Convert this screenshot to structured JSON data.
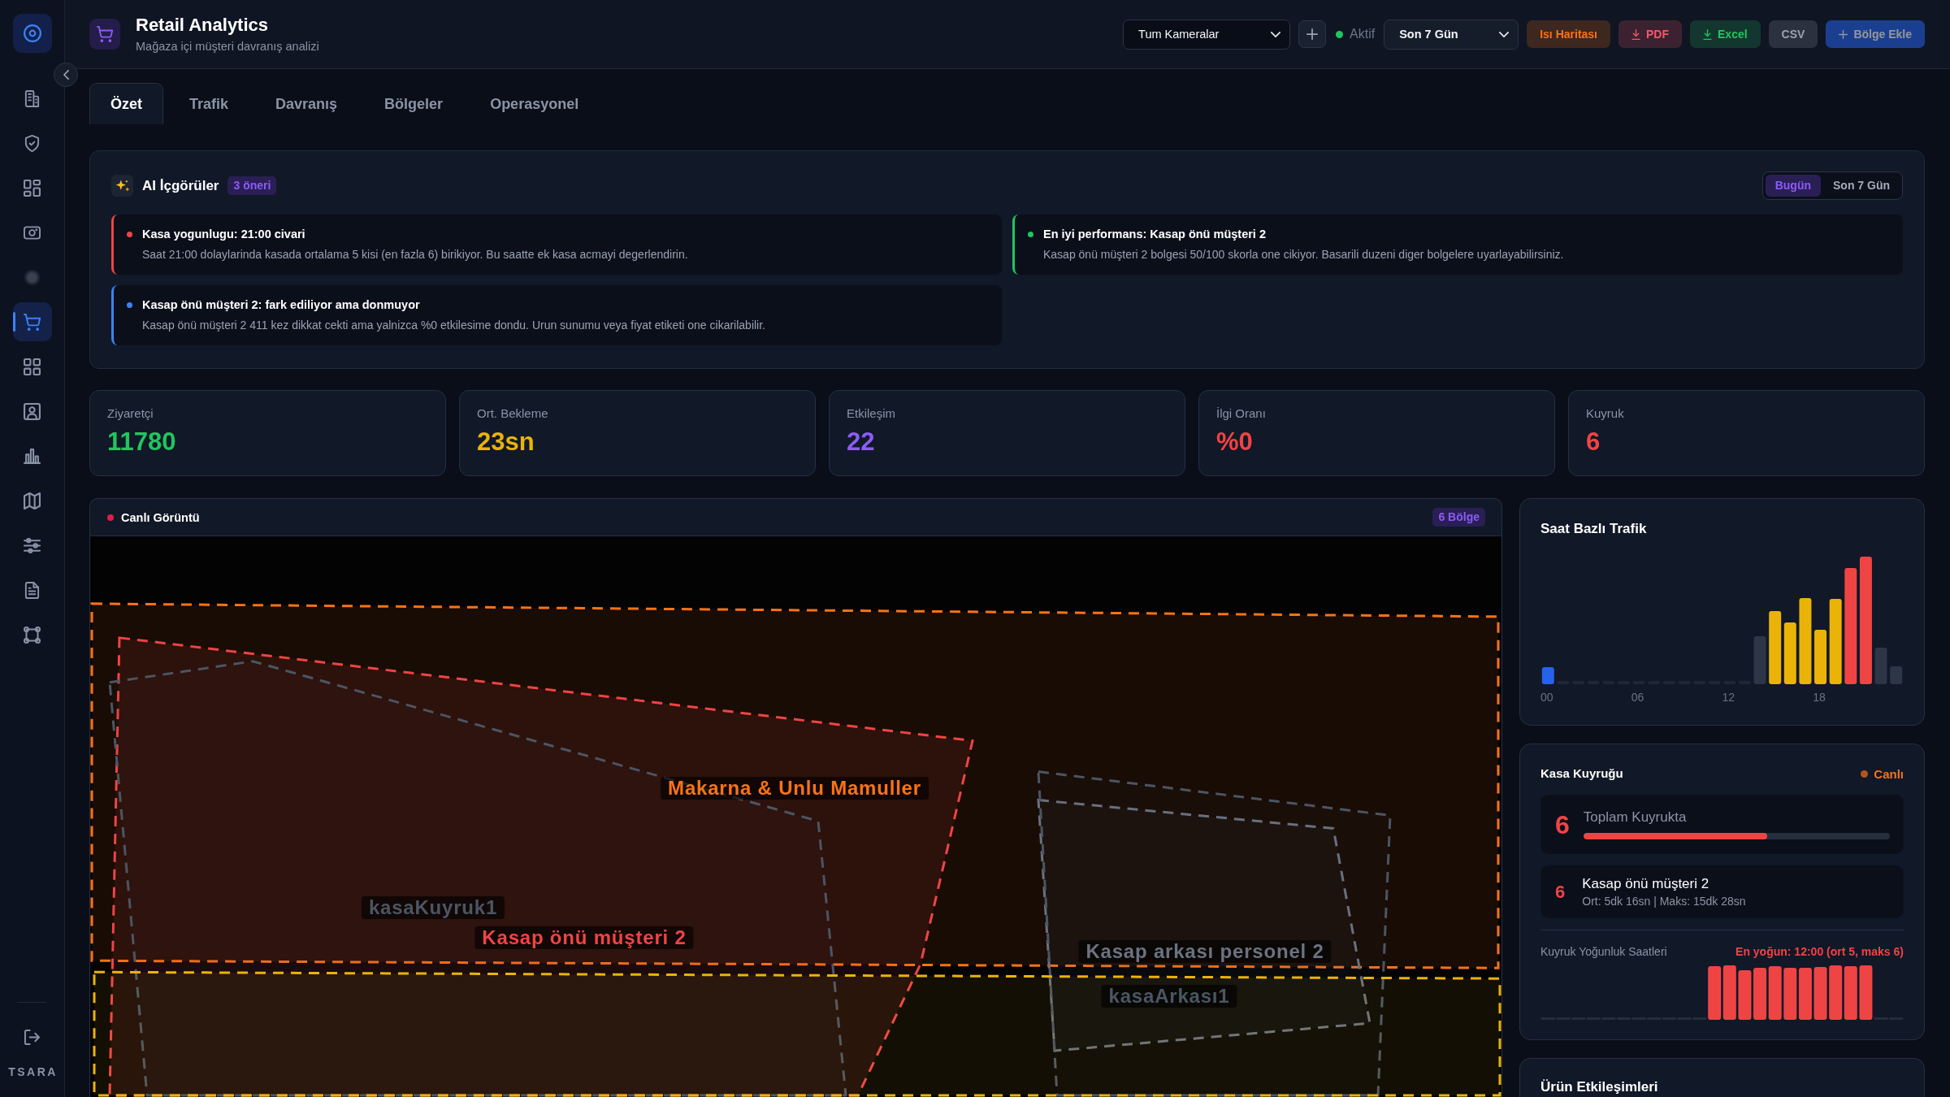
{
  "sidebar": {
    "items": [
      {
        "selected": false
      },
      {
        "selected": false
      },
      {
        "selected": false
      },
      {
        "selected": false
      },
      {
        "selected": false
      },
      {
        "selected": true
      },
      {
        "selected": false
      },
      {
        "selected": false
      },
      {
        "selected": false
      },
      {
        "selected": false
      },
      {
        "selected": false
      },
      {
        "selected": false
      },
      {
        "selected": false
      }
    ],
    "brand": "TSARA"
  },
  "header": {
    "title": "Retail Analytics",
    "subtitle": "Mağaza içi müşteri davranış analizi",
    "camera_select": {
      "value": "Tum Kameralar"
    },
    "status": {
      "label": "Aktif",
      "on": true
    },
    "period_select": {
      "value": "Son 7 Gün"
    },
    "buttons": [
      {
        "label": "Isı Haritası",
        "kind": "heatmap",
        "disabled": false
      },
      {
        "label": "PDF",
        "kind": "pdf",
        "disabled": false
      },
      {
        "label": "Excel",
        "kind": "excel",
        "disabled": false
      },
      {
        "label": "CSV",
        "kind": "csv",
        "disabled": false
      },
      {
        "label": "Bölge Ekle",
        "kind": "add",
        "disabled": true
      }
    ]
  },
  "tabs": [
    {
      "label": "Özet",
      "selected": true
    },
    {
      "label": "Trafik",
      "selected": false
    },
    {
      "label": "Davranış",
      "selected": false
    },
    {
      "label": "Bölgeler",
      "selected": false
    },
    {
      "label": "Operasyonel",
      "selected": false
    }
  ],
  "insights": {
    "title": "AI İçgörüler",
    "badge": "3 öneri",
    "range": [
      {
        "label": "Bugün",
        "selected": true
      },
      {
        "label": "Son 7 Gün",
        "selected": false
      }
    ],
    "items": [
      {
        "title": "Kasa yogunlugu: 21:00 civari",
        "text": "Saat 21:00 dolaylarinda kasada ortalama 5 kisi (en fazla 6) birikiyor. Bu saatte ek kasa acmayi degerlendirin.",
        "color": "#ef4444"
      },
      {
        "title": "En iyi performans: Kasap önü müşteri 2",
        "text": "Kasap önü müşteri 2 bolgesi 50/100 skorla one cikiyor. Basarili duzeni diger bolgelere uyarlayabilirsiniz.",
        "color": "#22c55e"
      },
      {
        "title": "Kasap önü müşteri 2: fark ediliyor ama donmuyor",
        "text": "Kasap önü müşteri 2 411 kez dikkat cekti ama yalnizca %0 etkilesime dondu. Urun sunumu veya fiyat etiketi one cikarilabilir.",
        "color": "#3b82f6"
      }
    ]
  },
  "kpis": [
    {
      "label": "Ziyaretçi",
      "value": "11780",
      "color": "#22c55e"
    },
    {
      "label": "Ort. Bekleme",
      "value": "23sn",
      "color": "#eab308"
    },
    {
      "label": "Etkileşim",
      "value": "22",
      "color": "#8b5cf6"
    },
    {
      "label": "İlgi Oranı",
      "value": "%0",
      "color": "#ef4444"
    },
    {
      "label": "Kuyruk",
      "value": "6",
      "color": "#ef4444"
    }
  ],
  "live_view": {
    "title": "Canlı Görüntü",
    "badge": "6 Bölge",
    "zones": [
      {
        "label": "Makarna & Unlu Mamuller",
        "color": "#f97316"
      },
      {
        "label": "Kasap önü müşteri 2",
        "color": "#ef4444"
      },
      {
        "label": "kasaKuyruk1",
        "color": "#4b5563"
      },
      {
        "label": "Kasap arkası personel 2",
        "color": "#6b7280"
      },
      {
        "label": "kasaArkası1",
        "color": "#4b5563"
      },
      {
        "color": "#eab308"
      }
    ]
  },
  "hourly_traffic": {
    "title": "Saat Bazlı Trafik",
    "axis_labels": [
      "00",
      "06",
      "12",
      "18"
    ]
  },
  "checkout_queue": {
    "title": "Kasa Kuyruğu",
    "live_label": "Canlı",
    "total": {
      "value": "6",
      "label": "Toplam Kuyrukta",
      "level": 0.6
    },
    "zones": [
      {
        "value": "6",
        "name": "Kasap önü müşteri 2",
        "detail": "Ort: 5dk 16sn | Maks: 15dk 28sn"
      }
    ],
    "density": {
      "title": "Kuyruk Yoğunluk Saatleri",
      "peak": "En yoğun: 12:00 (ort 5, maks 6)"
    }
  },
  "product_interactions": {
    "title": "Ürün Etkileşimleri"
  }
}
